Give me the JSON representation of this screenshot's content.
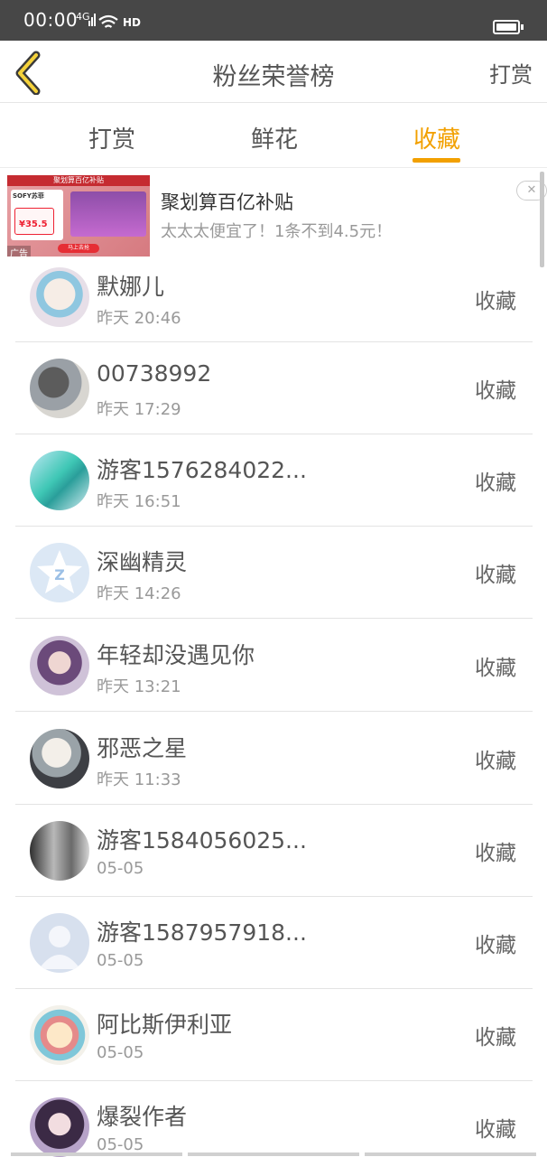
{
  "status_bar": {
    "time": "00:00",
    "signal_label": "4G",
    "hd_label": "HD"
  },
  "nav": {
    "title": "粉丝荣誉榜",
    "right_label": "打赏"
  },
  "tabs": [
    {
      "label": "打赏",
      "active": false
    },
    {
      "label": "鲜花",
      "active": false
    },
    {
      "label": "收藏",
      "active": true
    }
  ],
  "colors": {
    "accent": "#f2a000",
    "status_bar": "#474747",
    "divider": "#e3e3e3"
  },
  "ad": {
    "title": "聚划算百亿补贴",
    "subtitle": "太太太便宜了！1条不到4.5元！",
    "tag": "广告",
    "close_icon": "close-icon",
    "image": {
      "banner": "聚划算百亿补贴",
      "brand": "SOFY苏菲",
      "price": "¥35.5",
      "button": "马上去抢"
    }
  },
  "rows": [
    {
      "name": "默娜儿",
      "time": "昨天 20:46",
      "action": "收藏",
      "avatar": "anime-girl-avatar"
    },
    {
      "name": "00738992",
      "time": "昨天 17:29",
      "action": "收藏",
      "avatar": "bird-avatar"
    },
    {
      "name": "游客1576284022...",
      "time": "昨天 16:51",
      "action": "收藏",
      "avatar": "anime-teal-avatar"
    },
    {
      "name": "深幽精灵",
      "time": "昨天 14:26",
      "action": "收藏",
      "avatar": "qq-default-avatar"
    },
    {
      "name": "年轻却没遇见你",
      "time": "昨天 13:21",
      "action": "收藏",
      "avatar": "portrait-avatar"
    },
    {
      "name": "邪恶之星",
      "time": "昨天 11:33",
      "action": "收藏",
      "avatar": "anime-boy-avatar"
    },
    {
      "name": "游客1584056025...",
      "time": "05-05",
      "action": "收藏",
      "avatar": "photo-avatar"
    },
    {
      "name": "游客1587957918...",
      "time": "05-05",
      "action": "收藏",
      "avatar": "default-user-avatar"
    },
    {
      "name": "阿比斯伊利亚",
      "time": "05-05",
      "action": "收藏",
      "avatar": "anime-colorful-avatar"
    },
    {
      "name": "爆裂作者",
      "time": "05-05",
      "action": "收藏",
      "avatar": "anime-dark-avatar"
    }
  ]
}
